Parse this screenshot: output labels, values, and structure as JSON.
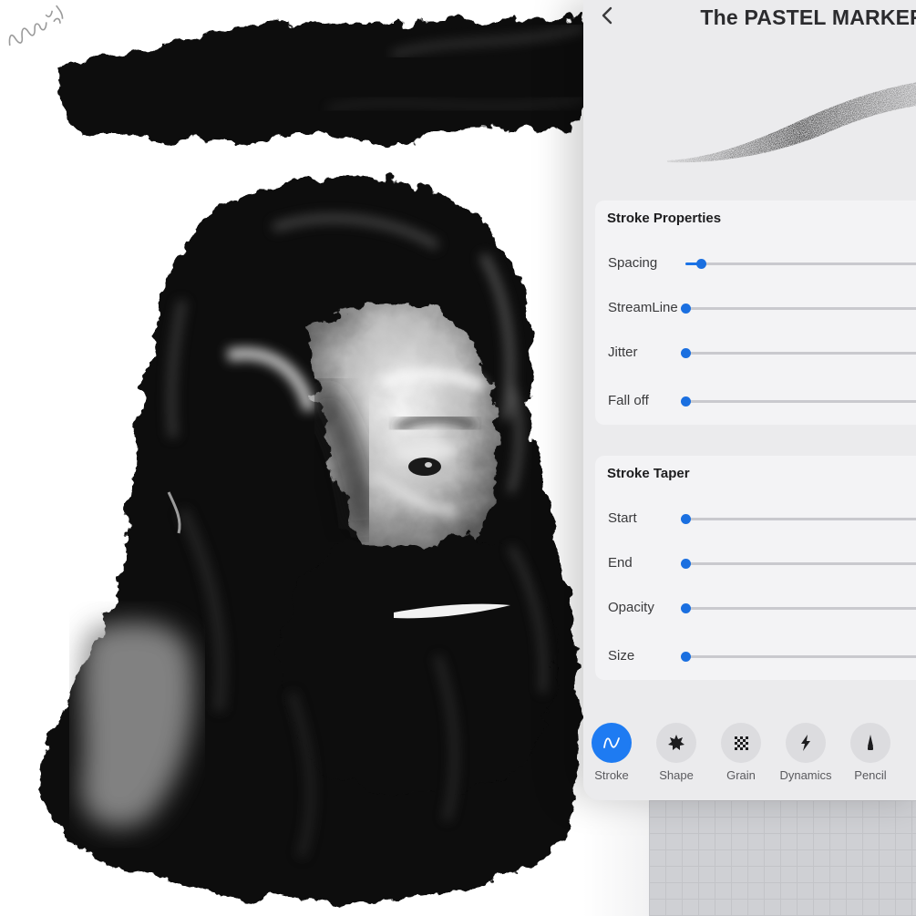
{
  "brush": {
    "title": "The PASTEL MARKER"
  },
  "stroke_properties": {
    "title": "Stroke Properties",
    "items": [
      {
        "label": "Spacing",
        "value": 0.06
      },
      {
        "label": "StreamLine",
        "value": 0
      },
      {
        "label": "Jitter",
        "value": 0
      },
      {
        "label": "Fall off",
        "value": 0
      }
    ]
  },
  "stroke_taper": {
    "title": "Stroke Taper",
    "items": [
      {
        "label": "Start",
        "value": 0
      },
      {
        "label": "End",
        "value": 0
      },
      {
        "label": "Opacity",
        "value": 0
      },
      {
        "label": "Size",
        "value": 0
      }
    ]
  },
  "tabs": [
    {
      "label": "Stroke",
      "icon": "stroke-wave-icon",
      "active": true
    },
    {
      "label": "Shape",
      "icon": "shape-star-icon",
      "active": false
    },
    {
      "label": "Grain",
      "icon": "grain-checker-icon",
      "active": false
    },
    {
      "label": "Dynamics",
      "icon": "dynamics-lightning-icon",
      "active": false
    },
    {
      "label": "Pencil",
      "icon": "pencil-tip-icon",
      "active": false
    }
  ],
  "colors": {
    "accent": "#1a73e8",
    "panel": "#ebebed",
    "card": "#f3f3f5"
  }
}
